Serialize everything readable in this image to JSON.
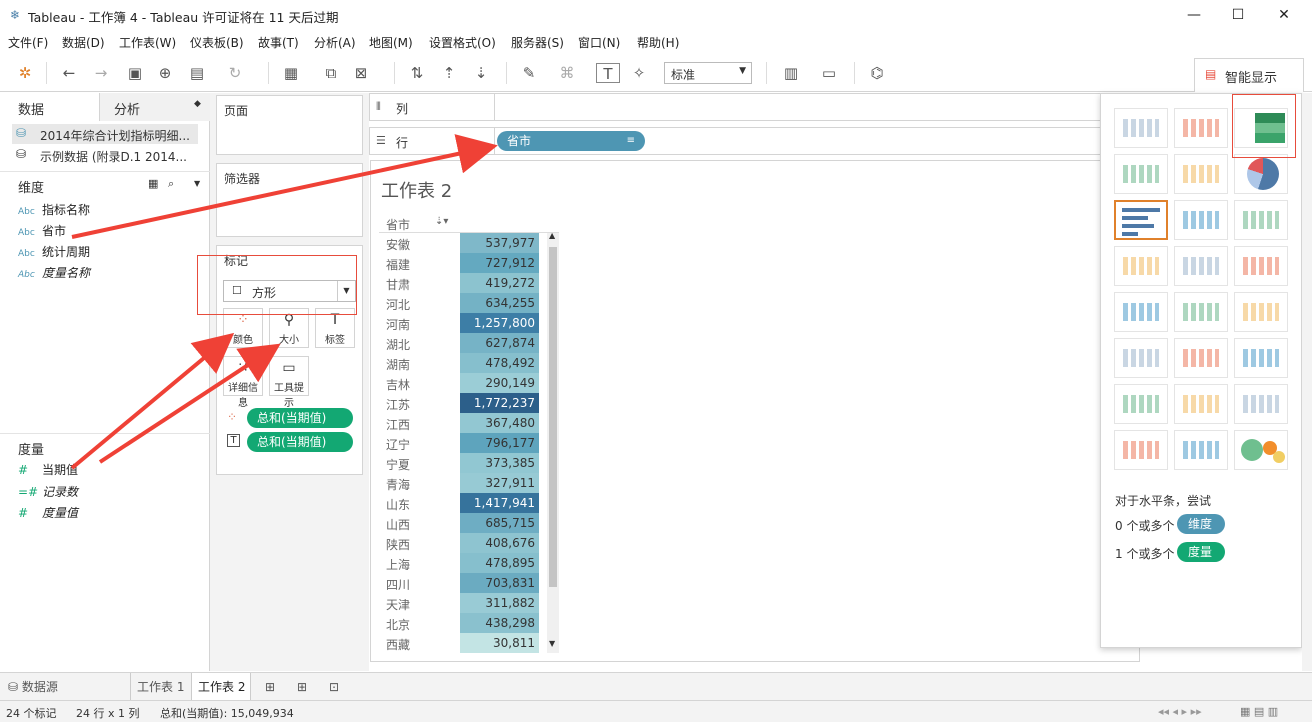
{
  "window": {
    "title": "Tableau - 工作簿 4 - Tableau 许可证将在 11 天后过期"
  },
  "menu": [
    "文件(F)",
    "数据(D)",
    "工作表(W)",
    "仪表板(B)",
    "故事(T)",
    "分析(A)",
    "地图(M)",
    "设置格式(O)",
    "服务器(S)",
    "窗口(N)",
    "帮助(H)"
  ],
  "toolbar": {
    "fit_value": "标准",
    "smart_show_label": "智能显示"
  },
  "left": {
    "tab_data": "数据",
    "tab_analysis": "分析",
    "datasources": [
      "2014年综合计划指标明细...",
      "示例数据 (附录D.1 2014..."
    ],
    "dimensions_title": "维度",
    "dimensions": [
      {
        "type": "Abc",
        "name": "指标名称"
      },
      {
        "type": "Abc",
        "name": "省市"
      },
      {
        "type": "Abc",
        "name": "统计周期"
      },
      {
        "type": "Abc",
        "name": "度量名称"
      }
    ],
    "measures_title": "度量",
    "measures": [
      {
        "type": "#",
        "name": "当期值"
      },
      {
        "type": "=#",
        "name": "记录数"
      },
      {
        "type": "#",
        "name": "度量值"
      }
    ]
  },
  "cards": {
    "pages": "页面",
    "filters": "筛选器",
    "marks": "标记",
    "mark_type": "方形",
    "mark_buttons": [
      "颜色",
      "大小",
      "标签",
      "详细信息",
      "工具提示"
    ],
    "mark_pills": [
      "总和(当期值)",
      "总和(当期值)"
    ]
  },
  "shelves": {
    "columns": "列",
    "rows": "行",
    "row_pill": "省市"
  },
  "sheet": {
    "title": "工作表 2",
    "column_header": "省市",
    "rows": [
      {
        "name": "安徽",
        "value": "537,977",
        "color": "#7fb8c9"
      },
      {
        "name": "福建",
        "value": "727,912",
        "color": "#64a9c0"
      },
      {
        "name": "甘肃",
        "value": "419,272",
        "color": "#8cc3cf"
      },
      {
        "name": "河北",
        "value": "634,255",
        "color": "#74b2c5"
      },
      {
        "name": "河南",
        "value": "1,257,800",
        "color": "#3d7ea6"
      },
      {
        "name": "湖北",
        "value": "627,874",
        "color": "#76b3c6"
      },
      {
        "name": "湖南",
        "value": "478,492",
        "color": "#86bfcd"
      },
      {
        "name": "吉林",
        "value": "290,149",
        "color": "#9bcdd6"
      },
      {
        "name": "江苏",
        "value": "1,772,237",
        "color": "#2c5f8a"
      },
      {
        "name": "江西",
        "value": "367,480",
        "color": "#92c7d2"
      },
      {
        "name": "辽宁",
        "value": "796,177",
        "color": "#5ea4bd"
      },
      {
        "name": "宁夏",
        "value": "373,385",
        "color": "#91c7d2"
      },
      {
        "name": "青海",
        "value": "327,911",
        "color": "#97cad4"
      },
      {
        "name": "山东",
        "value": "1,417,941",
        "color": "#36739c"
      },
      {
        "name": "山西",
        "value": "685,715",
        "color": "#6eadc3"
      },
      {
        "name": "陕西",
        "value": "408,676",
        "color": "#8ec4d0"
      },
      {
        "name": "上海",
        "value": "478,895",
        "color": "#86bfcd"
      },
      {
        "name": "四川",
        "value": "703,831",
        "color": "#6babc1"
      },
      {
        "name": "天津",
        "value": "311,882",
        "color": "#99cbd5"
      },
      {
        "name": "北京",
        "value": "438,298",
        "color": "#8ac1ce"
      },
      {
        "name": "西藏",
        "value": "30,811",
        "color": "#c3e4e4"
      }
    ]
  },
  "smart_show": {
    "hint_title": "对于水平条，尝试",
    "dim_req": "0 个或多个",
    "dim_pill": "维度",
    "mea_req": "1 个或多个",
    "mea_pill": "度量"
  },
  "bottom_tabs": {
    "datasource": "数据源",
    "sheet1": "工作表 1",
    "sheet2": "工作表 2"
  },
  "status": {
    "marks": "24 个标记",
    "dims": "24 行 x 1 列",
    "sum": "总和(当期值): 15,049,934"
  }
}
